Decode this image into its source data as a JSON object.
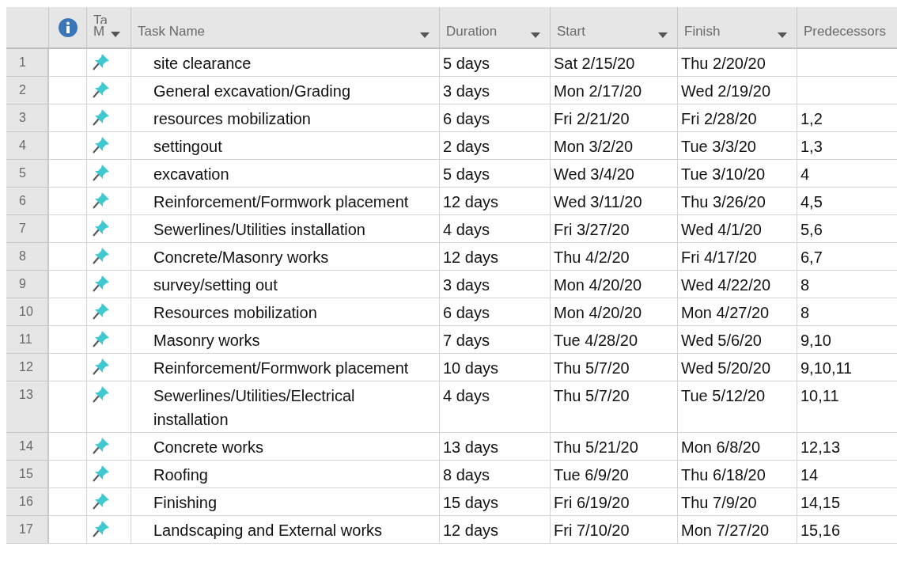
{
  "columns": [
    {
      "kind": "info"
    },
    {
      "kind": "mode",
      "label_top": "Ta",
      "label": "M"
    },
    {
      "kind": "text",
      "label": "Task Name"
    },
    {
      "kind": "text",
      "label": "Duration"
    },
    {
      "kind": "text",
      "label": "Start"
    },
    {
      "kind": "text",
      "label": "Finish"
    },
    {
      "kind": "plain",
      "label": "Predecessors"
    }
  ],
  "rows": [
    {
      "id": "1",
      "name": "site clearance",
      "duration": "5 days",
      "start": "Sat 2/15/20",
      "finish": "Thu 2/20/20",
      "predecessors": ""
    },
    {
      "id": "2",
      "name": "General excavation/Grading",
      "duration": "3 days",
      "start": "Mon 2/17/20",
      "finish": "Wed 2/19/20",
      "predecessors": ""
    },
    {
      "id": "3",
      "name": "resources mobilization",
      "duration": "6 days",
      "start": "Fri 2/21/20",
      "finish": "Fri 2/28/20",
      "predecessors": "1,2"
    },
    {
      "id": "4",
      "name": "settingout",
      "duration": "2 days",
      "start": "Mon 3/2/20",
      "finish": "Tue 3/3/20",
      "predecessors": "1,3"
    },
    {
      "id": "5",
      "name": "excavation",
      "duration": "5 days",
      "start": "Wed 3/4/20",
      "finish": "Tue 3/10/20",
      "predecessors": "4"
    },
    {
      "id": "6",
      "name": "Reinforcement/Formwork placement",
      "duration": "12 days",
      "start": "Wed 3/11/20",
      "finish": "Thu 3/26/20",
      "predecessors": "4,5"
    },
    {
      "id": "7",
      "name": "Sewerlines/Utilities installation",
      "duration": "4 days",
      "start": "Fri 3/27/20",
      "finish": "Wed 4/1/20",
      "predecessors": "5,6"
    },
    {
      "id": "8",
      "name": "Concrete/Masonry works",
      "duration": "12 days",
      "start": "Thu 4/2/20",
      "finish": "Fri 4/17/20",
      "predecessors": "6,7"
    },
    {
      "id": "9",
      "name": "survey/setting out",
      "duration": "3 days",
      "start": "Mon 4/20/20",
      "finish": "Wed 4/22/20",
      "predecessors": "8"
    },
    {
      "id": "10",
      "name": "Resources mobilization",
      "duration": "6 days",
      "start": "Mon 4/20/20",
      "finish": "Mon 4/27/20",
      "predecessors": "8"
    },
    {
      "id": "11",
      "name": "Masonry works",
      "duration": "7 days",
      "start": "Tue 4/28/20",
      "finish": "Wed 5/6/20",
      "predecessors": "9,10"
    },
    {
      "id": "12",
      "name": "Reinforcement/Formwork placement",
      "duration": "10 days",
      "start": "Thu 5/7/20",
      "finish": "Wed 5/20/20",
      "predecessors": "9,10,11"
    },
    {
      "id": "13",
      "name": "Sewerlines/Utilities/Electrical installation",
      "duration": "4 days",
      "start": "Thu 5/7/20",
      "finish": "Tue 5/12/20",
      "predecessors": "10,11"
    },
    {
      "id": "14",
      "name": "Concrete works",
      "duration": "13 days",
      "start": "Thu 5/21/20",
      "finish": "Mon 6/8/20",
      "predecessors": "12,13"
    },
    {
      "id": "15",
      "name": "Roofing",
      "duration": "8 days",
      "start": "Tue 6/9/20",
      "finish": "Thu 6/18/20",
      "predecessors": "14"
    },
    {
      "id": "16",
      "name": "Finishing",
      "duration": "15 days",
      "start": "Fri 6/19/20",
      "finish": "Thu 7/9/20",
      "predecessors": "14,15"
    },
    {
      "id": "17",
      "name": "Landscaping and External works",
      "duration": "12 days",
      "start": "Fri 7/10/20",
      "finish": "Mon 7/27/20",
      "predecessors": "15,16"
    }
  ]
}
